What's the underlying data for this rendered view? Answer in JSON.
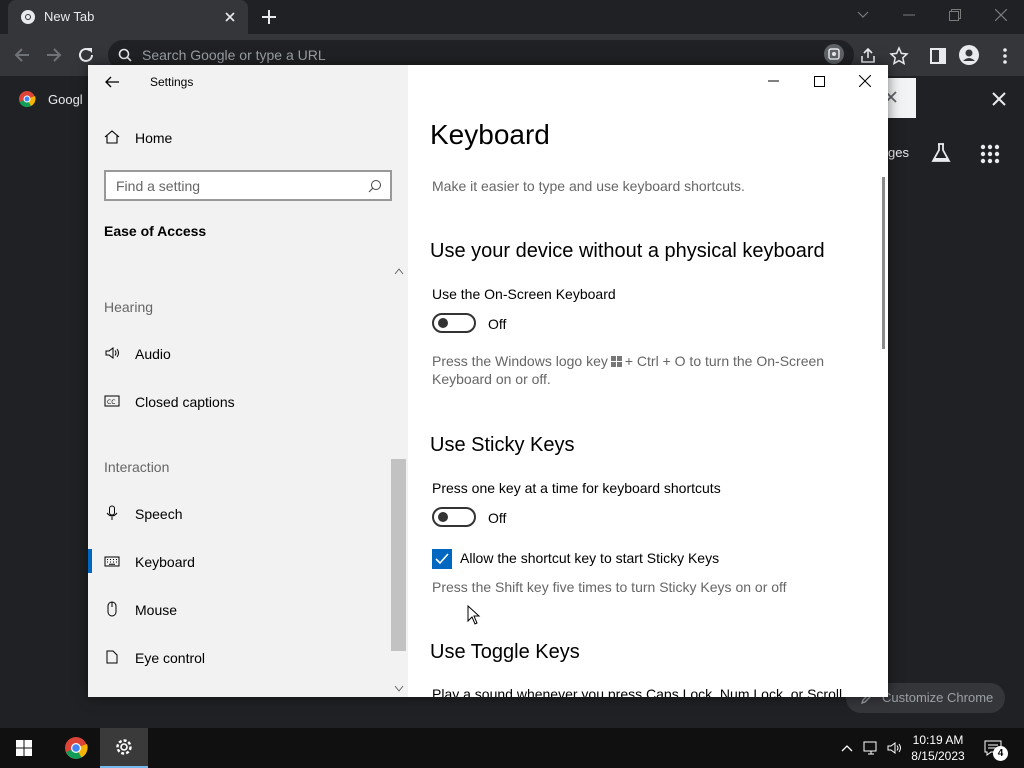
{
  "browser": {
    "tab_title": "New Tab",
    "omnibox_placeholder": "Search Google or type a URL",
    "bookmark_label": "Googl",
    "ntp_link": "ges",
    "customize_label": "Customize Chrome"
  },
  "settings": {
    "window_title": "Settings",
    "sidebar": {
      "home_label": "Home",
      "search_placeholder": "Find a setting",
      "section_heading": "Ease of Access",
      "groups": {
        "hearing": "Hearing",
        "interaction": "Interaction"
      },
      "items": {
        "audio": "Audio",
        "closed_captions": "Closed captions",
        "speech": "Speech",
        "keyboard": "Keyboard",
        "mouse": "Mouse",
        "eye_control": "Eye control"
      },
      "active_item": "Keyboard"
    },
    "content": {
      "title": "Keyboard",
      "subtitle": "Make it easier to type and use keyboard shortcuts.",
      "osk": {
        "heading": "Use your device without a physical keyboard",
        "label": "Use the On-Screen Keyboard",
        "state": "Off",
        "help_a": "Press the Windows logo key",
        "help_b": "+ Ctrl + O to turn the On-Screen Keyboard on or off."
      },
      "sticky": {
        "heading": "Use Sticky Keys",
        "label": "Press one key at a time for keyboard shortcuts",
        "state": "Off",
        "checkbox_label": "Allow the shortcut key to start Sticky Keys",
        "checkbox_checked": true,
        "help": "Press the Shift key five times to turn Sticky Keys on or off"
      },
      "toggle_keys": {
        "heading": "Use Toggle Keys",
        "partial_text": "Play a sound whenever you press Caps Lock, Num Lock, or Scroll"
      }
    }
  },
  "taskbar": {
    "time": "10:19 AM",
    "date": "8/15/2023",
    "notification_count": "4"
  },
  "colors": {
    "accent": "#0067c0",
    "chrome_dark": "#202124",
    "chrome_toolbar": "#35363a",
    "sidebar_bg": "#f2f2f2"
  }
}
